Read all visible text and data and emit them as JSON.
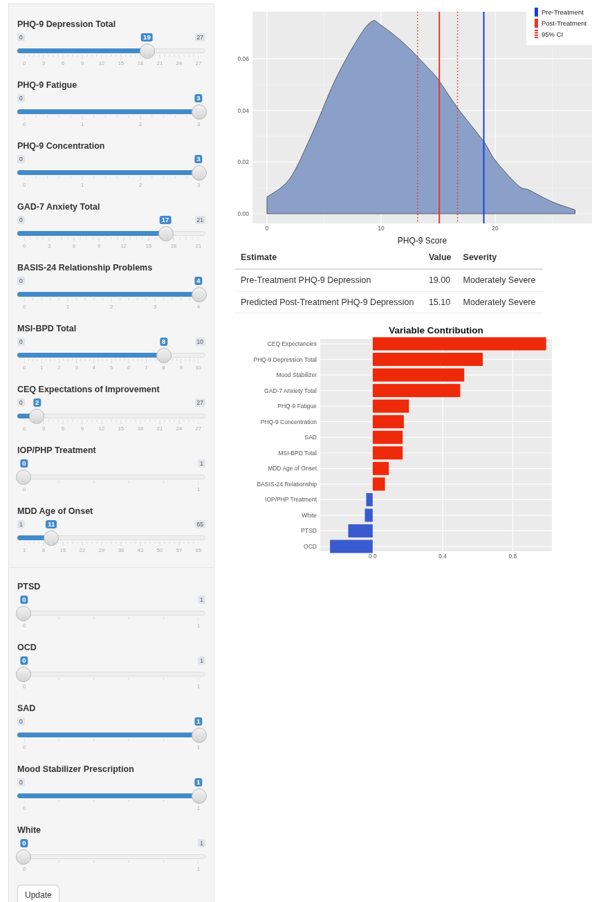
{
  "sidebar_panels": [
    {
      "sliders": [
        {
          "label": "PHQ-9 Depression Total",
          "min": "0",
          "max": "27",
          "value": "19",
          "level": 0.704,
          "ticks": [
            "0",
            "3",
            "6",
            "9",
            "12",
            "15",
            "18",
            "21",
            "24",
            "27"
          ]
        },
        {
          "label": "PHQ-9 Fatigue",
          "min": "0",
          "value": "3",
          "level": 1,
          "ticks": [
            "0",
            "1",
            "2",
            "3"
          ]
        },
        {
          "label": "PHQ-9 Concentration",
          "min": "0",
          "value": "3",
          "level": 1,
          "ticks": [
            "0",
            "1",
            "2",
            "3"
          ]
        },
        {
          "label": "GAD-7 Anxiety Total",
          "min": "0",
          "max": "21",
          "value": "17",
          "level": 0.81,
          "ticks": [
            "0",
            "3",
            "6",
            "9",
            "12",
            "15",
            "18",
            "21"
          ]
        },
        {
          "label": "BASIS-24 Relationship Problems",
          "min": "0",
          "value": "4",
          "level": 1,
          "ticks": [
            "0",
            "1",
            "2",
            "3",
            "4"
          ]
        },
        {
          "label": "MSI-BPD Total",
          "min": "0",
          "max": "10",
          "value": "8",
          "level": 0.8,
          "ticks": [
            "0",
            "1",
            "2",
            "3",
            "4",
            "5",
            "6",
            "7",
            "8",
            "9",
            "10"
          ]
        },
        {
          "label": "CEQ Expectations of Improvement",
          "min": "0",
          "max": "27",
          "value": "2",
          "level": 0.074,
          "ticks": [
            "0",
            "3",
            "6",
            "9",
            "12",
            "15",
            "18",
            "21",
            "24",
            "27"
          ]
        },
        {
          "label": "IOP/PHP Treatment",
          "max": "1",
          "value": "0",
          "level": 0,
          "ticks": [
            "0",
            "1"
          ]
        },
        {
          "label": "MDD Age of Onset",
          "min": "1",
          "max": "65",
          "value": "11",
          "level": 0.156,
          "ticks": [
            "1",
            "8",
            "15",
            "22",
            "29",
            "36",
            "43",
            "50",
            "57",
            "65"
          ]
        }
      ]
    },
    {
      "sliders": [
        {
          "label": "PTSD",
          "max": "1",
          "value": "0",
          "level": 0,
          "ticks": [
            "0",
            "1"
          ]
        },
        {
          "label": "OCD",
          "max": "1",
          "value": "0",
          "level": 0,
          "ticks": [
            "0",
            "1"
          ]
        },
        {
          "label": "SAD",
          "min": "0",
          "value": "1",
          "level": 1,
          "ticks": [
            "0",
            "1"
          ]
        },
        {
          "label": "Mood Stabilizer Prescription",
          "min": "0",
          "value": "1",
          "level": 1,
          "ticks": [
            "0",
            "1"
          ]
        },
        {
          "label": "White",
          "max": "1",
          "value": "0",
          "level": 0,
          "ticks": [
            "0",
            "1"
          ]
        }
      ],
      "button": "Update"
    }
  ],
  "density_plot": {
    "chart_data": {
      "type": "area",
      "xlabel": "PHQ-9 Score",
      "x": [
        0,
        2,
        4,
        6,
        8,
        9.2,
        10,
        12,
        14,
        15,
        16.7,
        19,
        20,
        22,
        23,
        25,
        27
      ],
      "grid": true,
      "series": [
        {
          "color": "#8ba0c8",
          "values": [
            0.0065,
            0.0136,
            0.0314,
            0.052,
            0.068,
            0.0745,
            0.073,
            0.066,
            0.057,
            0.052,
            0.041,
            0.0279,
            0.0207,
            0.011,
            0.0091,
            0.0046,
            0.0015
          ]
        }
      ],
      "xlim": [
        -1.27,
        28.48
      ],
      "ylim": [
        -0.00375,
        0.0782
      ],
      "xticks": [
        0,
        10,
        20
      ],
      "yticks": [
        {
          "value": 0,
          "label": "0.00"
        },
        {
          "value": 0.02,
          "label": "0.02"
        },
        {
          "value": 0.04,
          "label": "0.04"
        },
        {
          "value": 0.06,
          "label": "0.06"
        }
      ],
      "ref_lines": [
        {
          "axis": "x",
          "value": 19,
          "color": "#1c3ee0"
        },
        {
          "axis": "x",
          "value": 15.1,
          "color": "#e8322a"
        },
        {
          "axis": "x",
          "value": 13.2,
          "color": "#e8322a"
        },
        {
          "axis": "x",
          "value": 16.7,
          "color": "#e8322a"
        }
      ]
    },
    "legend": [
      {
        "label": "Pre-Treatment",
        "color": "#1c3ee0",
        "kind": "solid"
      },
      {
        "label": "Post-Treatment",
        "color": "#e8322a",
        "kind": "solid"
      },
      {
        "label": "95% CI",
        "color": "#e8322a",
        "kind": "dotted"
      }
    ]
  },
  "estimates_table": {
    "columns": [
      "Estimate",
      "Value",
      "Severity"
    ],
    "rows": [
      [
        "Pre-Treatment PHQ-9 Depression",
        "19.00",
        "Moderately Severe"
      ],
      [
        "Predicted Post-Treatment PHQ-9 Depression",
        "15.10",
        "Moderately Severe"
      ]
    ]
  },
  "contribution_plot": {
    "chart_data": {
      "type": "bar",
      "orientation": "horizontal",
      "title": "Variable Contribution",
      "categories": [
        "CEQ Expectancies",
        "PHQ-9 Depression Total",
        "Mood Stabilizer",
        "GAD-7 Anxiety Total",
        "PHQ-9 Fatigue",
        "PHQ-9 Concentration",
        "SAD",
        "MSI-BPD Total",
        "MDD Age of Onset",
        "BASIS-24 Relationship",
        "IOP/PHP Treatment",
        "White",
        "PTSD",
        "OCD"
      ],
      "grid": true,
      "series": [
        {
          "values": [
            0.991,
            0.629,
            0.523,
            0.5,
            0.207,
            0.178,
            0.171,
            0.171,
            0.092,
            0.07,
            -0.037,
            -0.045,
            -0.14,
            -0.244
          ]
        }
      ],
      "colors": [
        "#ee2a0b",
        "#ee2a0b",
        "#ee2a0b",
        "#ee2a0b",
        "#ee2a0b",
        "#ee2a0b",
        "#ee2a0b",
        "#ee2a0b",
        "#ee2a0b",
        "#ee2a0b",
        "#3a5bd0",
        "#3a5bd0",
        "#3a5bd0",
        "#3a5bd0"
      ],
      "xlim": [
        -0.3,
        1.024
      ],
      "xticks": [
        {
          "value": 0,
          "label": "0.0"
        },
        {
          "value": 0.4,
          "label": "0.4"
        },
        {
          "value": 0.8,
          "label": "0.8"
        }
      ]
    }
  }
}
